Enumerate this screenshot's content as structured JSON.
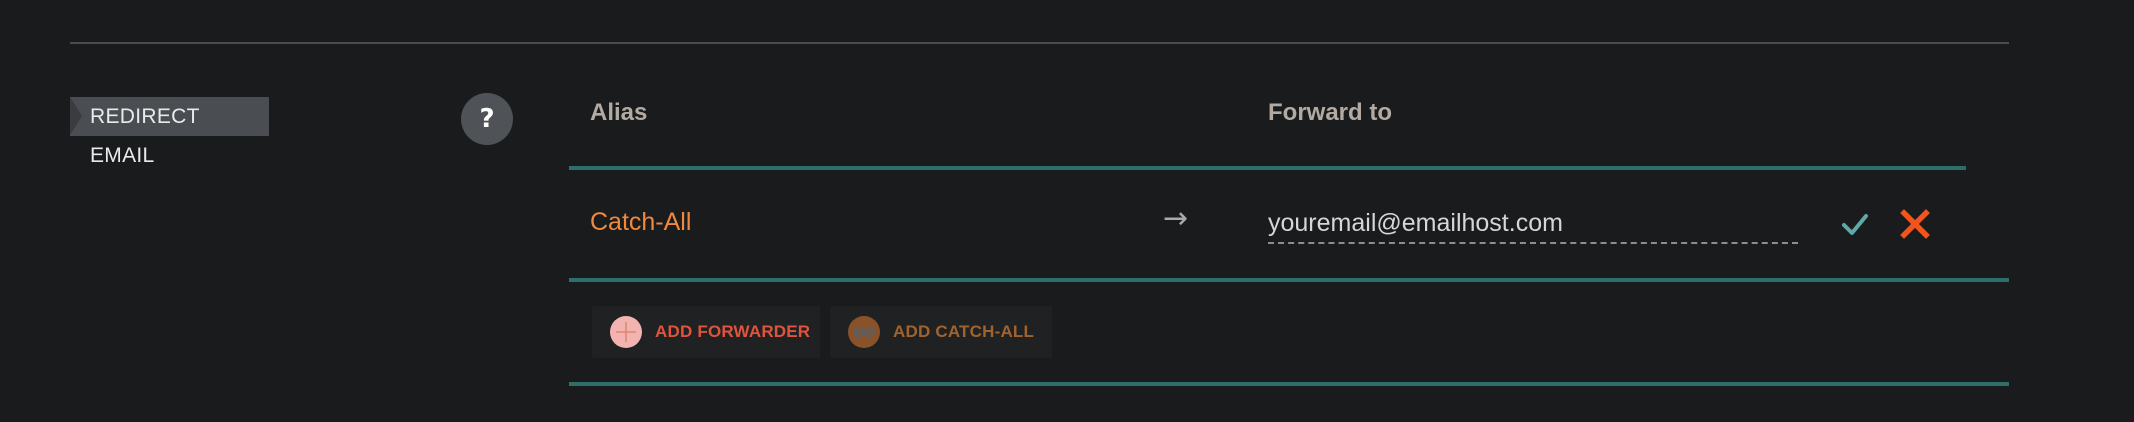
{
  "section": {
    "label": "REDIRECT EMAIL",
    "help_label": "?"
  },
  "table": {
    "headers": {
      "alias": "Alias",
      "forward_to": "Forward to"
    },
    "rows": [
      {
        "alias": "Catch-All",
        "arrow": "→",
        "forward_placeholder": "youremail@emailhost.com",
        "confirm_icon": "check-icon",
        "cancel_icon": "close-icon"
      }
    ]
  },
  "actions": {
    "add_forwarder_label": "ADD FORWARDER",
    "add_forwarder_icon": "plus-icon",
    "add_catchall_label": "ADD CATCH-ALL",
    "add_catchall_icon": "infinity-icon"
  },
  "colors": {
    "background": "#1a1b1c",
    "teal_divider": "#2f6d68",
    "alias_orange": "#f0883e",
    "confirm_teal": "#5fa8a8",
    "cancel_orange": "#f2541b",
    "forwarder_red": "#e0533c",
    "catchall_brown": "#a2622c"
  }
}
